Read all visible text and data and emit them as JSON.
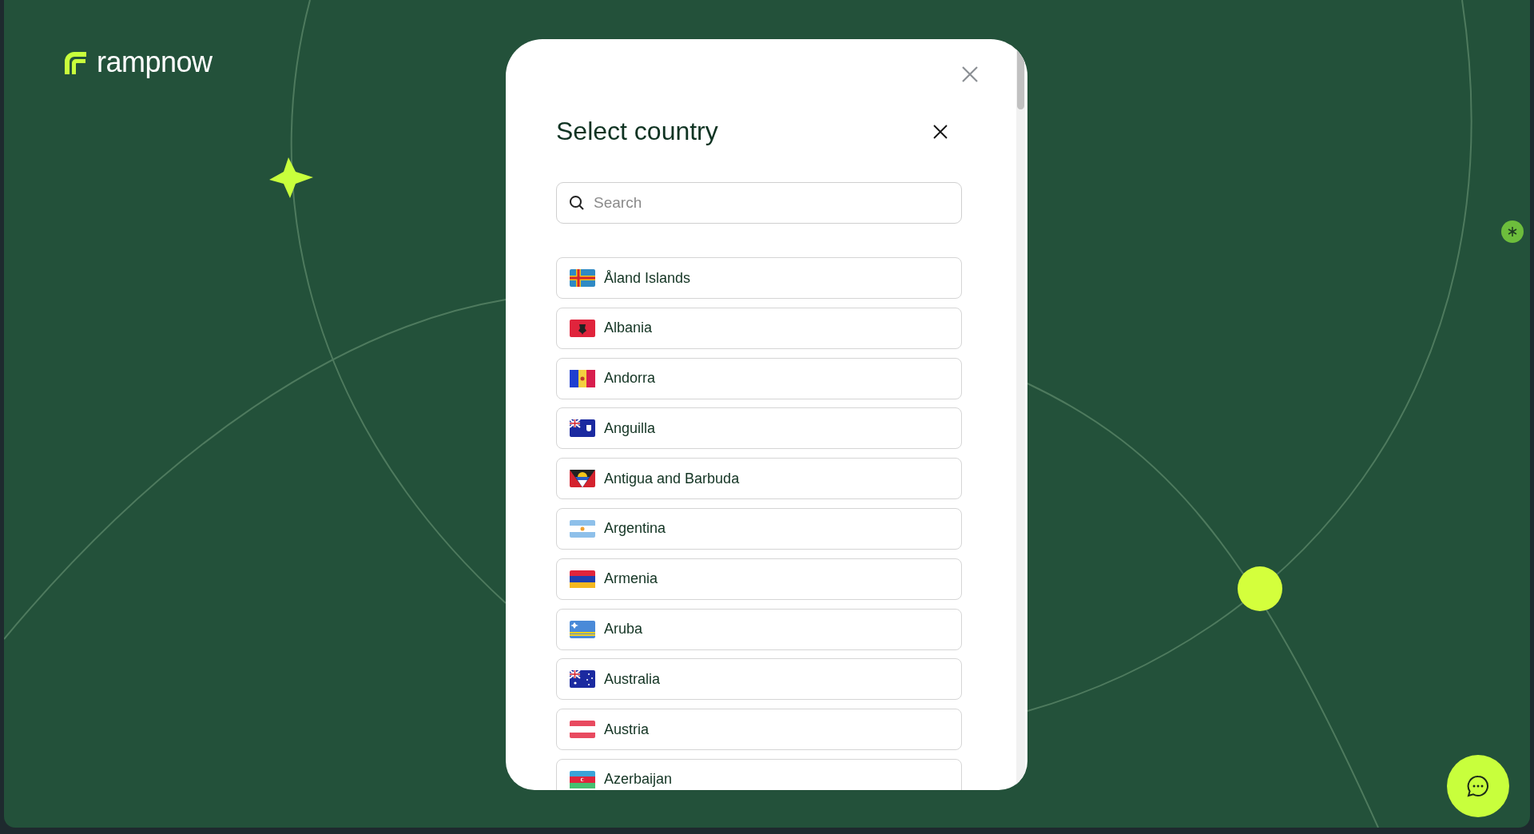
{
  "brand": {
    "name": "rampnow"
  },
  "dialog": {
    "title": "Select country",
    "search": {
      "placeholder": "Search"
    },
    "countries": [
      {
        "name": "Åland Islands"
      },
      {
        "name": "Albania"
      },
      {
        "name": "Andorra"
      },
      {
        "name": "Anguilla"
      },
      {
        "name": "Antigua and Barbuda"
      },
      {
        "name": "Argentina"
      },
      {
        "name": "Armenia"
      },
      {
        "name": "Aruba"
      },
      {
        "name": "Australia"
      },
      {
        "name": "Austria"
      },
      {
        "name": "Azerbaijan"
      }
    ]
  }
}
